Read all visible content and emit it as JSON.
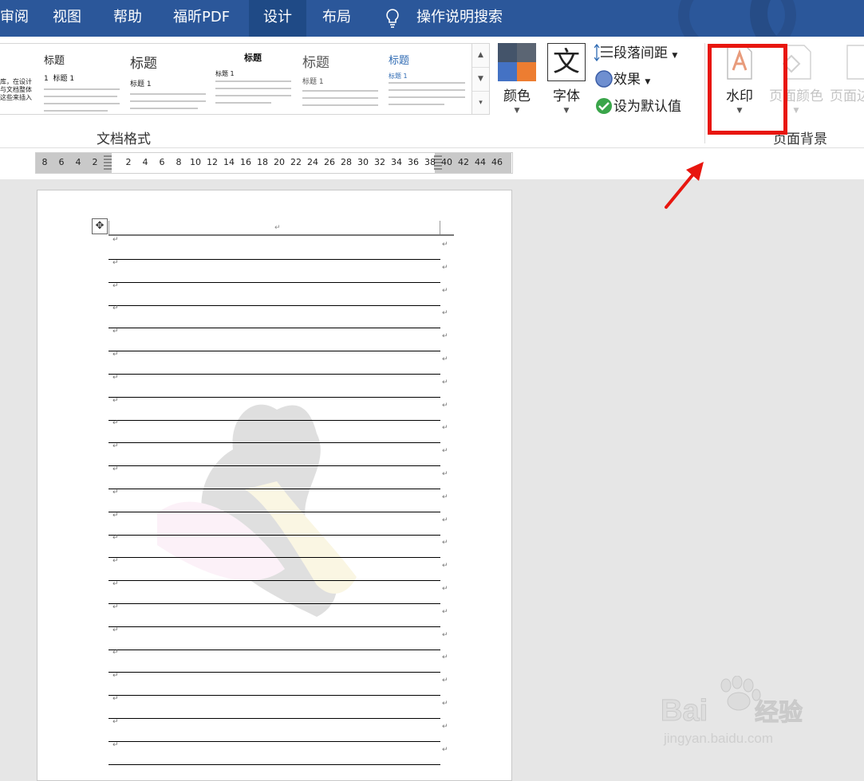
{
  "menubar": {
    "tabs": [
      {
        "label": "审阅"
      },
      {
        "label": "视图"
      },
      {
        "label": "帮助"
      },
      {
        "label": "福昕PDF"
      },
      {
        "label": "设计",
        "active": true
      },
      {
        "label": "布局"
      }
    ],
    "tell_me": "操作说明搜索",
    "color": "#2b579a"
  },
  "ribbon": {
    "style_gallery": {
      "items": [
        {
          "heading": "标题",
          "sub_heading": "标题 1",
          "number_prefix": "1"
        },
        {
          "heading": "标题",
          "sub_heading": "标题 1"
        },
        {
          "heading": "标题",
          "sub_heading": "标题 1"
        },
        {
          "heading": "标题",
          "sub_heading": "标题 1"
        },
        {
          "heading": "标题",
          "sub_heading": "标题 1"
        }
      ],
      "group_label": "文档格式"
    },
    "colors_label": "颜色",
    "fonts_label": "字体",
    "fonts_glyph": "文",
    "paragraph_spacing_label": "段落间距",
    "effects_label": "效果",
    "set_default_label": "设为默认值",
    "watermark_label": "水印",
    "page_color_label": "页面颜色",
    "page_border_label": "页面边",
    "page_background_group": "页面背景"
  },
  "ruler": {
    "left_numbers": [
      "8",
      "6",
      "4",
      "2"
    ],
    "right_numbers": [
      "2",
      "4",
      "6",
      "8",
      "10",
      "12",
      "14",
      "16",
      "18",
      "20",
      "22",
      "24",
      "26",
      "28",
      "30",
      "32",
      "34",
      "36",
      "38",
      "40",
      "42",
      "44",
      "46"
    ]
  },
  "document": {
    "paragraph_mark": "↵",
    "move_handle": "✥",
    "row_count": 23
  },
  "annotation": {
    "highlight_color": "#e8160f"
  },
  "watermark_logo": {
    "brand": "Baidu经验",
    "url": "jingyan.baidu.com"
  }
}
